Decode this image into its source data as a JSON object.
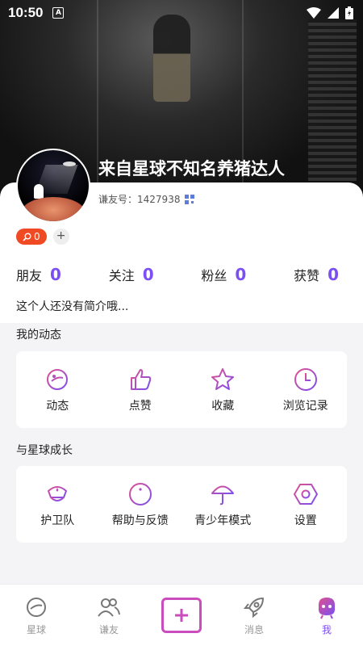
{
  "status_bar": {
    "time": "10:50"
  },
  "profile": {
    "name": "来自星球不知名养猪达人",
    "id_label": "谦友号：",
    "id_value": "1427938",
    "badge_count": "0",
    "bio": "这个人还没有简介哦..."
  },
  "stats": [
    {
      "label": "朋友",
      "value": "0"
    },
    {
      "label": "关注",
      "value": "0"
    },
    {
      "label": "粉丝",
      "value": "0"
    },
    {
      "label": "获赞",
      "value": "0"
    }
  ],
  "my_activity": {
    "title": "我的动态",
    "items": [
      {
        "label": "动态",
        "icon": "planet-icon"
      },
      {
        "label": "点赞",
        "icon": "thumbs-up-icon"
      },
      {
        "label": "收藏",
        "icon": "star-icon"
      },
      {
        "label": "浏览记录",
        "icon": "clock-icon"
      }
    ]
  },
  "grow": {
    "title": "与星球成长",
    "items": [
      {
        "label": "护卫队",
        "icon": "guard-cap-icon"
      },
      {
        "label": "帮助与反馈",
        "icon": "info-icon"
      },
      {
        "label": "青少年模式",
        "icon": "umbrella-icon"
      },
      {
        "label": "设置",
        "icon": "hexagon-settings-icon"
      }
    ]
  },
  "nav": [
    {
      "label": "星球",
      "icon": "planet-icon",
      "active": false
    },
    {
      "label": "谦友",
      "icon": "friends-icon",
      "active": false
    },
    {
      "label": "",
      "icon": "add-post-icon",
      "active": false
    },
    {
      "label": "消息",
      "icon": "rocket-icon",
      "active": false
    },
    {
      "label": "我",
      "icon": "me-face-icon",
      "active": true
    }
  ],
  "colors": {
    "accent": "#7b4ff2",
    "badge": "#f04a24",
    "icon_grad_start": "#e0508f",
    "icon_grad_end": "#7b4ff2"
  }
}
